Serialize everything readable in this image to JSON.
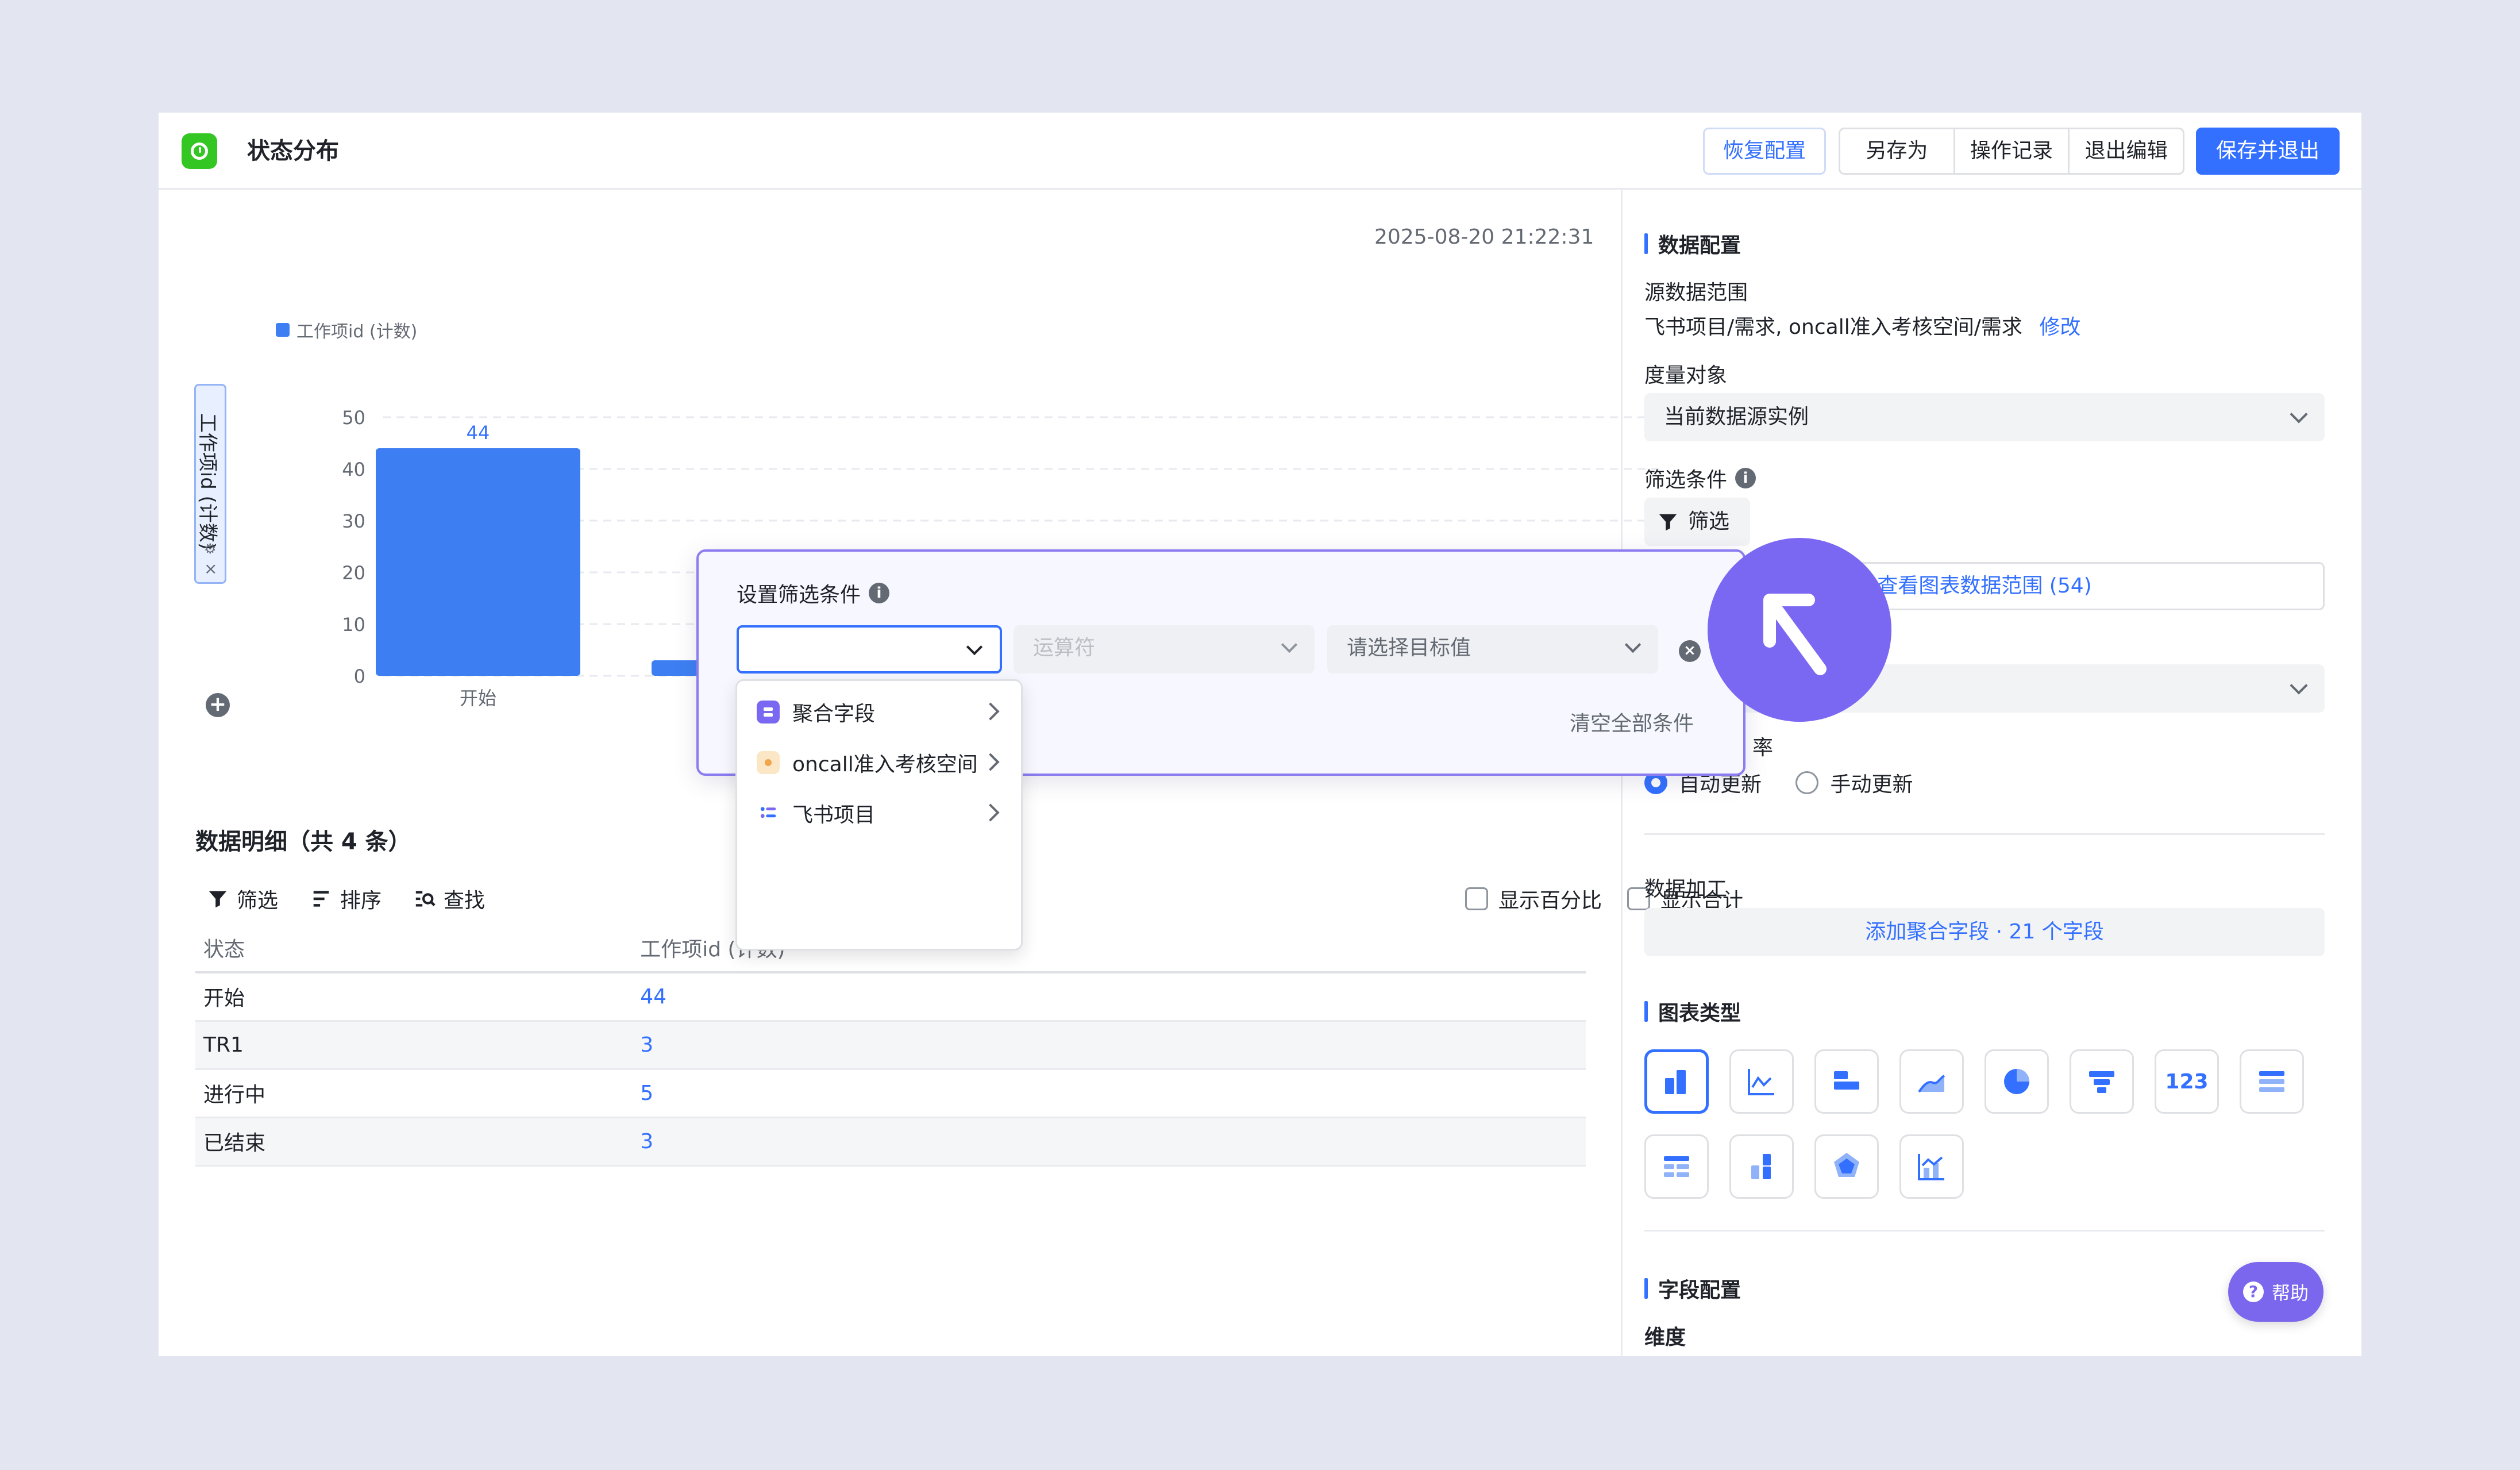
{
  "header": {
    "title": "状态分布",
    "restore_label": "恢复配置",
    "save_as_label": "另存为",
    "history_label": "操作记录",
    "exit_edit_label": "退出编辑",
    "save_exit_label": "保存并退出"
  },
  "chart_panel": {
    "timestamp": "2025-08-20 21:22:31",
    "y_axis_tag": "工作项id (计数)",
    "legend": "工作项id (计数)"
  },
  "chart_data": {
    "type": "bar",
    "categories": [
      "开始",
      "TR1",
      "进行中",
      "已结束"
    ],
    "series": [
      {
        "name": "工作项id (计数)",
        "values": [
          44,
          3,
          5,
          3
        ]
      }
    ],
    "ylim": [
      0,
      50
    ],
    "yticks": [
      0,
      10,
      20,
      30,
      40,
      50
    ],
    "grid": true,
    "legend_position": "top-left",
    "bar_color": "#3d7ff2"
  },
  "detail": {
    "title": "数据明细（共 4 条）",
    "toolbar": {
      "filter": "筛选",
      "sort": "排序",
      "search": "查找"
    },
    "show_percent": "显示百分比",
    "show_total": "显示合计",
    "columns": [
      "状态",
      "工作项id (计数)"
    ],
    "rows": [
      {
        "status": "开始",
        "count": "44"
      },
      {
        "status": "TR1",
        "count": "3"
      },
      {
        "status": "进行中",
        "count": "5"
      },
      {
        "status": "已结束",
        "count": "3"
      }
    ]
  },
  "config": {
    "data_config_title": "数据配置",
    "source_range_label": "源数据范围",
    "source_range_value": "飞书项目/需求, oncall准入考核空间/需求",
    "modify_link": "修改",
    "measure_label": "度量对象",
    "measure_value": "当前数据源实例",
    "filter_label": "筛选条件",
    "filter_button": "筛选",
    "view_range_link": "查看图表数据范围 (54)",
    "update_freq_suffix": "率",
    "auto_update": "自动更新",
    "manual_update": "手动更新",
    "processing_label": "数据加工",
    "add_agg_link": "添加聚合字段 · 21 个字段",
    "chart_type_title": "图表类型",
    "chart_types": [
      "bar-chart-icon",
      "line-chart-icon",
      "horizontal-bar-icon",
      "area-chart-icon",
      "pie-chart-icon",
      "funnel-chart-icon",
      "number-card-icon",
      "list-table-icon",
      "pivot-table-icon",
      "stacked-bar-icon",
      "radar-chart-icon",
      "combo-chart-icon"
    ],
    "number_card_text": "123",
    "field_config_title": "字段配置",
    "dimension_label": "维度"
  },
  "filter_popover": {
    "title": "设置筛选条件",
    "field_placeholder": "",
    "operator_placeholder": "运算符",
    "value_placeholder": "请选择目标值",
    "clear_all": "清空全部条件",
    "menu": [
      {
        "label": "聚合字段",
        "icon": "aggregate-icon"
      },
      {
        "label": "oncall准入考核空间",
        "icon": "space-icon"
      },
      {
        "label": "飞书项目",
        "icon": "project-icon"
      }
    ]
  },
  "help": {
    "label": "帮助"
  },
  "colors": {
    "accent": "#3370ff",
    "purple": "#7b68f2",
    "green": "#34c724"
  }
}
